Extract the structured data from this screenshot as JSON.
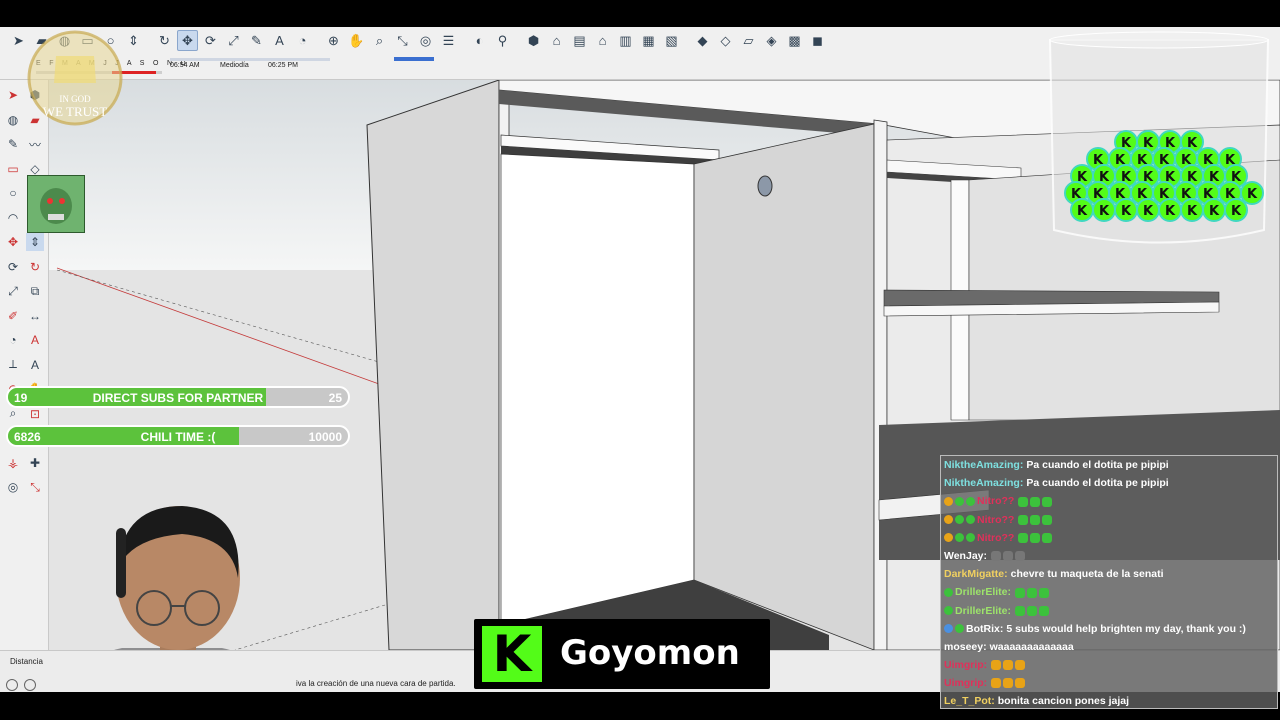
{
  "toolbar": {
    "shadow_months": "E F M A M J J A S O N D",
    "shadow_time_start": "06:54 AM",
    "shadow_time_mid": "Mediodía",
    "shadow_time_end": "06:25 PM",
    "icons": [
      "select-icon",
      "eraser-icon",
      "paint-icon",
      "rectangle-icon",
      "circle-icon",
      "push-pull-icon",
      "follow-me-icon",
      "move-icon",
      "rotate-icon",
      "scale-icon",
      "tape-measure-icon",
      "text-icon",
      "protractor-icon",
      "orbit-icon",
      "pan-icon",
      "zoom-icon",
      "zoom-extents-icon",
      "section-icon",
      "x-ray-icon",
      "shadows-icon",
      "walk-icon",
      "components-icon",
      "iso-view-icon",
      "top-view-icon",
      "front-view-icon",
      "right-view-icon",
      "back-view-icon",
      "left-view-icon",
      "xray-style-icon",
      "wireframe-style-icon",
      "hidden-line-icon",
      "shaded-icon",
      "shaded-texture-icon",
      "monochrome-icon"
    ]
  },
  "logo": {
    "line1": "IN GOD",
    "line2": "WE TRUST"
  },
  "goals": [
    {
      "left": "19",
      "label": "DIRECT SUBS FOR PARTNER",
      "right": "25",
      "progress": 0.76
    },
    {
      "left": "6826",
      "label": "CHILI TIME :(",
      "right": "10000",
      "progress": 0.68
    }
  ],
  "status": {
    "measure_label": "Distancia",
    "hint": "iva la creación de una nueva cara de partida."
  },
  "kick": {
    "logo": "K",
    "name": "Goyomon"
  },
  "chat": [
    {
      "user": "NiktheAmazing:",
      "text": "Pa cuando el dotita pe pipipi",
      "color": "#7ee0e0",
      "badges": []
    },
    {
      "user": "NiktheAmazing:",
      "text": "Pa cuando el dotita pe pipipi",
      "color": "#7ee0e0",
      "badges": []
    },
    {
      "user": "Nitro??",
      "text": "",
      "color": "#e0305a",
      "badges": [
        "#e8a317",
        "#3cc23c",
        "#3cc23c"
      ]
    },
    {
      "user": "Nitro??",
      "text": "",
      "color": "#e0305a",
      "badges": [
        "#e8a317",
        "#3cc23c",
        "#3cc23c"
      ]
    },
    {
      "user": "Nitro??",
      "text": "",
      "color": "#e0305a",
      "badges": [
        "#e8a317",
        "#3cc23c",
        "#3cc23c"
      ]
    },
    {
      "user": "WenJay:",
      "text": "",
      "color": "#ffffff",
      "badges": []
    },
    {
      "user": "DarkMigatte:",
      "text": "chevre tu maqueta de la senati",
      "color": "#f0d060",
      "badges": []
    },
    {
      "user": "DrillerElite:",
      "text": "",
      "color": "#9de36b",
      "badges": [
        "#3cc23c"
      ]
    },
    {
      "user": "DrillerElite:",
      "text": "",
      "color": "#9de36b",
      "badges": [
        "#3cc23c"
      ]
    },
    {
      "user": "BotRix:",
      "text": "5 subs would help brighten my day, thank you :)",
      "color": "#ffffff",
      "badges": [
        "#4a90e2",
        "#3cc23c"
      ]
    },
    {
      "user": "moseey:",
      "text": "waaaaaaaaaaaaa",
      "color": "#ffffff",
      "badges": []
    },
    {
      "user": "Uimgrip:",
      "text": "",
      "color": "#e0305a",
      "badges": []
    },
    {
      "user": "Uimgrip:",
      "text": "",
      "color": "#e0305a",
      "badges": []
    },
    {
      "user": "Le_T_Pot:",
      "text": "bonita cancion pones jajaj",
      "color": "#f0d060",
      "badges": []
    }
  ],
  "colors": {
    "kick_green": "#53fc18",
    "goal_green": "#5cc23c",
    "toolbar_bg": "#f0f0f0"
  }
}
